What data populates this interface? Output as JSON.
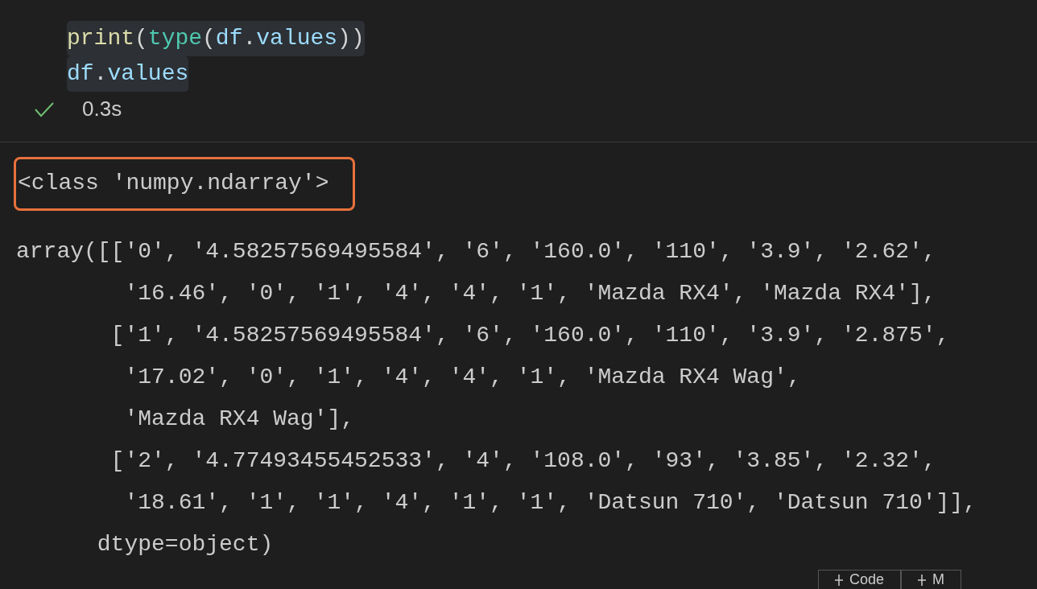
{
  "code_cell": {
    "lines": [
      [
        {
          "kind": "function",
          "text": "print"
        },
        {
          "kind": "punct",
          "text": "("
        },
        {
          "kind": "builtin",
          "text": "type"
        },
        {
          "kind": "punct",
          "text": "("
        },
        {
          "kind": "variable",
          "text": "df"
        },
        {
          "kind": "punct",
          "text": "."
        },
        {
          "kind": "variable",
          "text": "values"
        },
        {
          "kind": "punct",
          "text": "))"
        }
      ],
      [
        {
          "kind": "variable",
          "text": "df"
        },
        {
          "kind": "punct",
          "text": "."
        },
        {
          "kind": "variable",
          "text": "values"
        }
      ]
    ],
    "status": {
      "succeeded": true,
      "duration": "0.3s"
    }
  },
  "output": {
    "type_line": {
      "text": "<class 'numpy.ndarray'>",
      "highlighted": true
    },
    "lines": [
      "array([['0', '4.58257569495584', '6', '160.0', '110', '3.9', '2.62',",
      "        '16.46', '0', '1', '4', '4', '1', 'Mazda RX4', 'Mazda RX4'],",
      "       ['1', '4.58257569495584', '6', '160.0', '110', '3.9', '2.875',",
      "        '17.02', '0', '1', '4', '4', '1', 'Mazda RX4 Wag',",
      "        'Mazda RX4 Wag'],",
      "       ['2', '4.77493455452533', '4', '108.0', '93', '3.85', '2.32',",
      "        '18.61', '1', '1', '4', '1', '1', 'Datsun 710', 'Datsun 710']],",
      "      dtype=object)"
    ]
  },
  "toolbar": {
    "buttons": [
      "Code",
      "M"
    ]
  }
}
